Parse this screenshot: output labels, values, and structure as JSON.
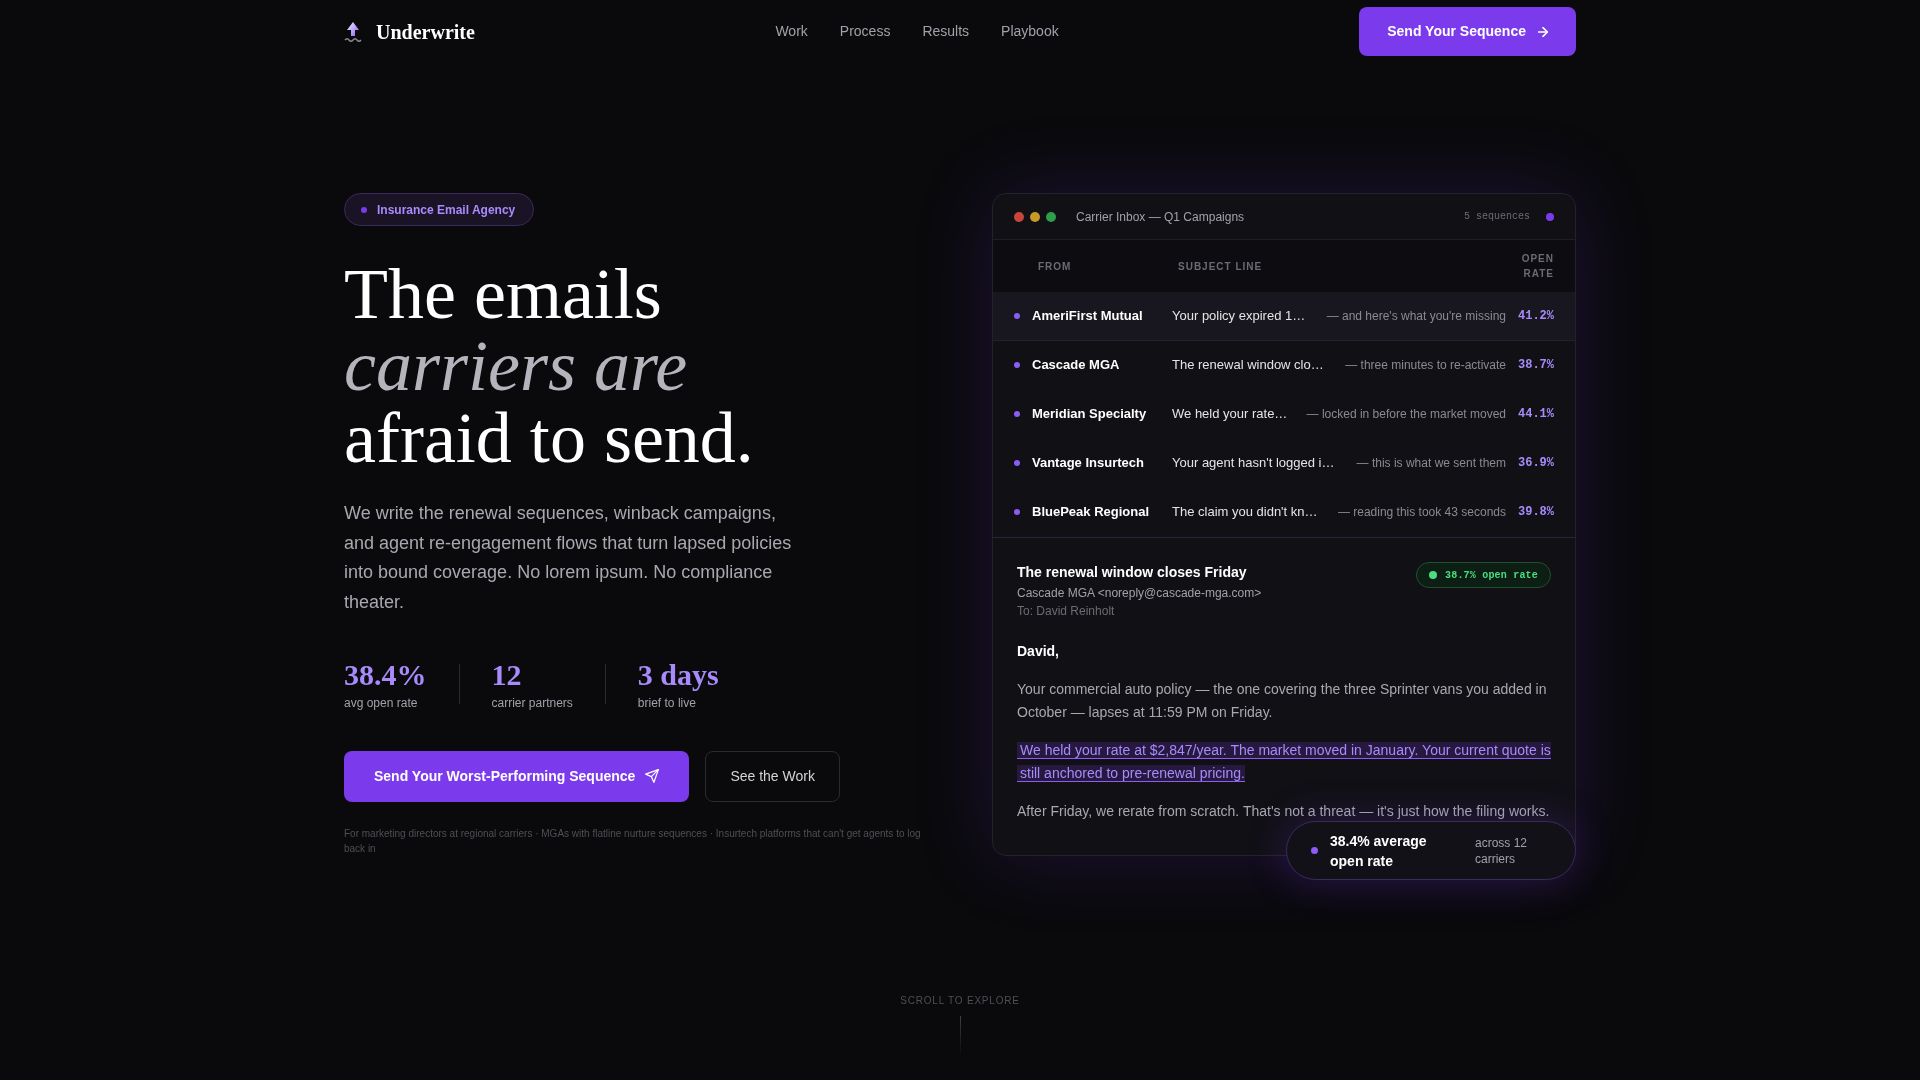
{
  "nav": {
    "brand": "Underwrite",
    "links": [
      "Work",
      "Process",
      "Results",
      "Playbook"
    ],
    "cta": "Send Your Sequence"
  },
  "hero": {
    "badge": "Insurance Email Agency",
    "headline": [
      {
        "text": "The emails",
        "kind": "plain"
      },
      {
        "text": "carriers are",
        "kind": "emphasis"
      },
      {
        "text": "afraid to send.",
        "kind": "plain"
      }
    ],
    "description": "We write the renewal sequences, winback campaigns, and agent re-engagement flows that turn lapsed policies into bound coverage. No lorem ipsum. No compliance theater.",
    "stats": [
      {
        "value": "38.4%",
        "label": "avg open rate"
      },
      {
        "value": "12",
        "label": "carrier partners"
      },
      {
        "value": "3 days",
        "label": "brief to live"
      }
    ],
    "primary_button": "Send Your Worst-Performing Sequence",
    "secondary_button": "See the Work",
    "audience_note": "For marketing directors at regional carriers · MGAs with flatline nurture sequences · Insurtech platforms that can't get agents to log back in"
  },
  "inbox": {
    "title": "Carrier Inbox — Q1 Campaigns",
    "sequence_count": "5 sequences",
    "columns": [
      "FROM",
      "SUBJECT LINE",
      "OPEN RATE"
    ],
    "rows": [
      {
        "from": "AmeriFirst Mutual",
        "subject": "Your policy expired 1…",
        "preview": "— and here's what you're missing",
        "open_rate": "41.2%",
        "selected": true
      },
      {
        "from": "Cascade MGA",
        "subject": "The renewal window clo…",
        "preview": "— three minutes to re-activate",
        "open_rate": "38.7%",
        "selected": false
      },
      {
        "from": "Meridian Specialty",
        "subject": "We held your rate…",
        "preview": "— locked in before the market moved",
        "open_rate": "44.1%",
        "selected": false
      },
      {
        "from": "Vantage Insurtech",
        "subject": "Your agent hasn't logged i…",
        "preview": "— this is what we sent them",
        "open_rate": "36.9%",
        "selected": false
      },
      {
        "from": "BluePeak Regional",
        "subject": "The claim you didn't kn…",
        "preview": "— reading this took 43 seconds",
        "open_rate": "39.8%",
        "selected": false
      }
    ],
    "email": {
      "subject": "The renewal window closes Friday",
      "sender": "Cascade MGA <noreply@cascade-mga.com>",
      "recipient": "To: David Reinholt",
      "badge": "38.7% open rate",
      "greeting": "David,",
      "paragraphs": [
        {
          "kind": "plain",
          "text": "Your commercial auto policy — the one covering the three Sprinter vans you added in October — lapses at 11:59 PM on Friday."
        },
        {
          "kind": "highlight",
          "text": "We held your rate at $2,847/year. The market moved in January. Your current quote is still anchored to pre-renewal pricing."
        },
        {
          "kind": "plain",
          "text": "After Friday, we rerate from scratch. That's not a threat — it's just how the filing works."
        }
      ]
    }
  },
  "floating_stat": {
    "headline": "38.4% average open rate",
    "detail": "across 12 carriers"
  },
  "scroll_hint": "SCROLL TO EXPLORE"
}
